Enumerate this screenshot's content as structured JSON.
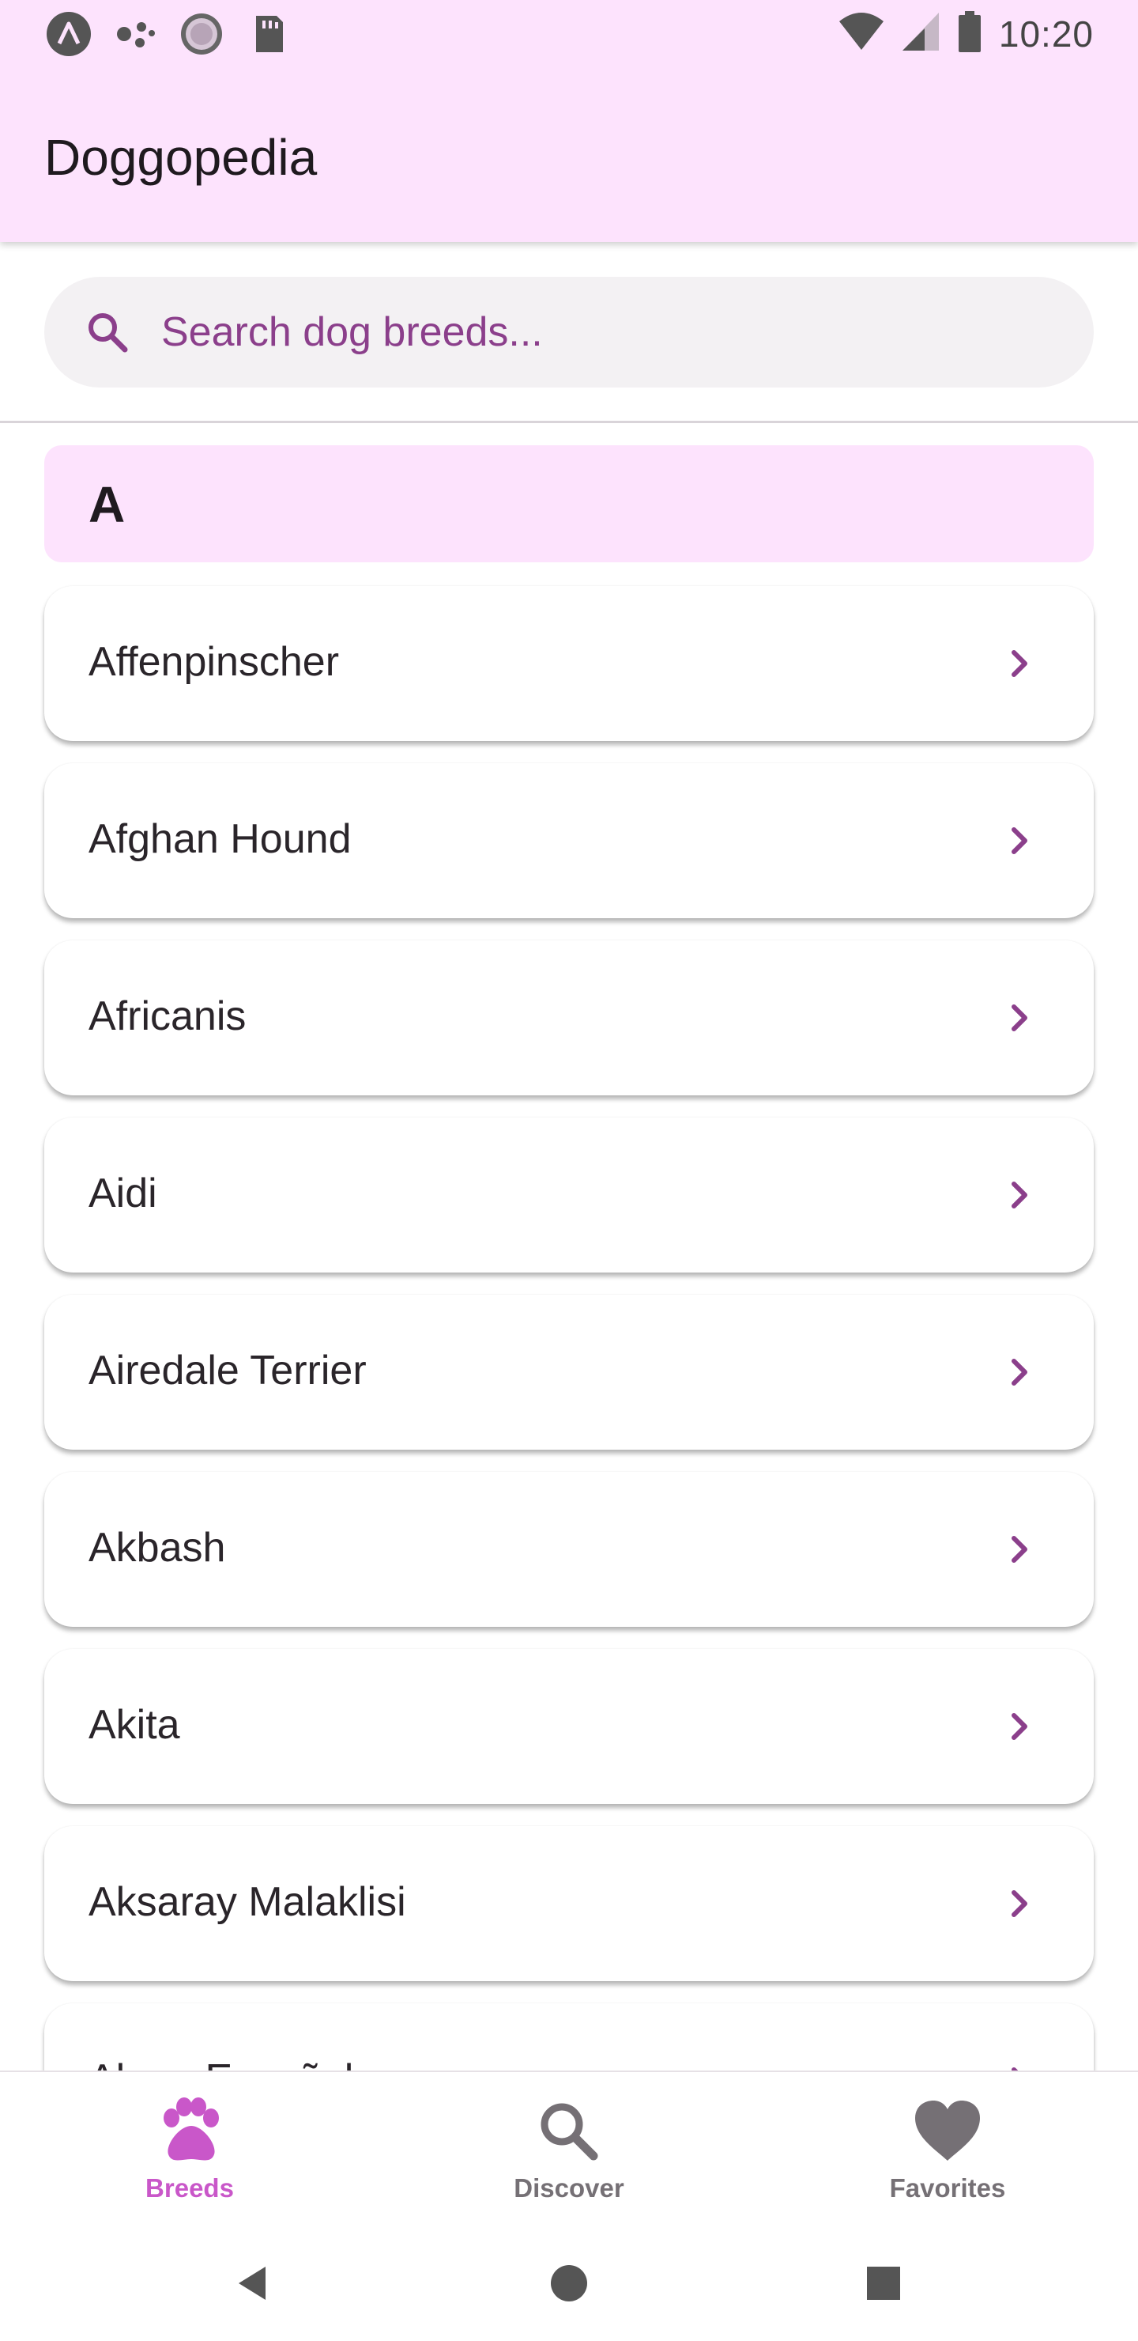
{
  "status_bar": {
    "time": "10:20",
    "left_icons": [
      "launcher-a-icon",
      "dots-icon",
      "sync-circle-icon",
      "sd-card-icon"
    ],
    "right_icons": [
      "wifi-icon",
      "cellular-signal-icon",
      "battery-icon"
    ]
  },
  "app_bar": {
    "title": "Doggopedia"
  },
  "search": {
    "placeholder": "Search dog breeds...",
    "value": "",
    "icon": "search-icon"
  },
  "list": {
    "section_letter": "A",
    "items": [
      {
        "name": "Affenpinscher"
      },
      {
        "name": "Afghan Hound"
      },
      {
        "name": "Africanis"
      },
      {
        "name": "Aidi"
      },
      {
        "name": "Airedale Terrier"
      },
      {
        "name": "Akbash"
      },
      {
        "name": "Akita"
      },
      {
        "name": "Aksaray Malaklisi"
      },
      {
        "name": "Alano Español"
      }
    ],
    "item_icon": "chevron-right-icon"
  },
  "bottom_nav": {
    "items": [
      {
        "label": "Breeds",
        "icon": "paw-icon",
        "active": true
      },
      {
        "label": "Discover",
        "icon": "search-icon",
        "active": false
      },
      {
        "label": "Favorites",
        "icon": "heart-icon",
        "active": false
      }
    ]
  },
  "system_nav": {
    "buttons": [
      "back-icon",
      "home-icon",
      "recents-icon"
    ]
  },
  "colors": {
    "app_bar_bg": "#fde3fd",
    "accent": "#8b3f8b",
    "nav_active": "#c957c9",
    "nav_inactive": "#757075"
  }
}
